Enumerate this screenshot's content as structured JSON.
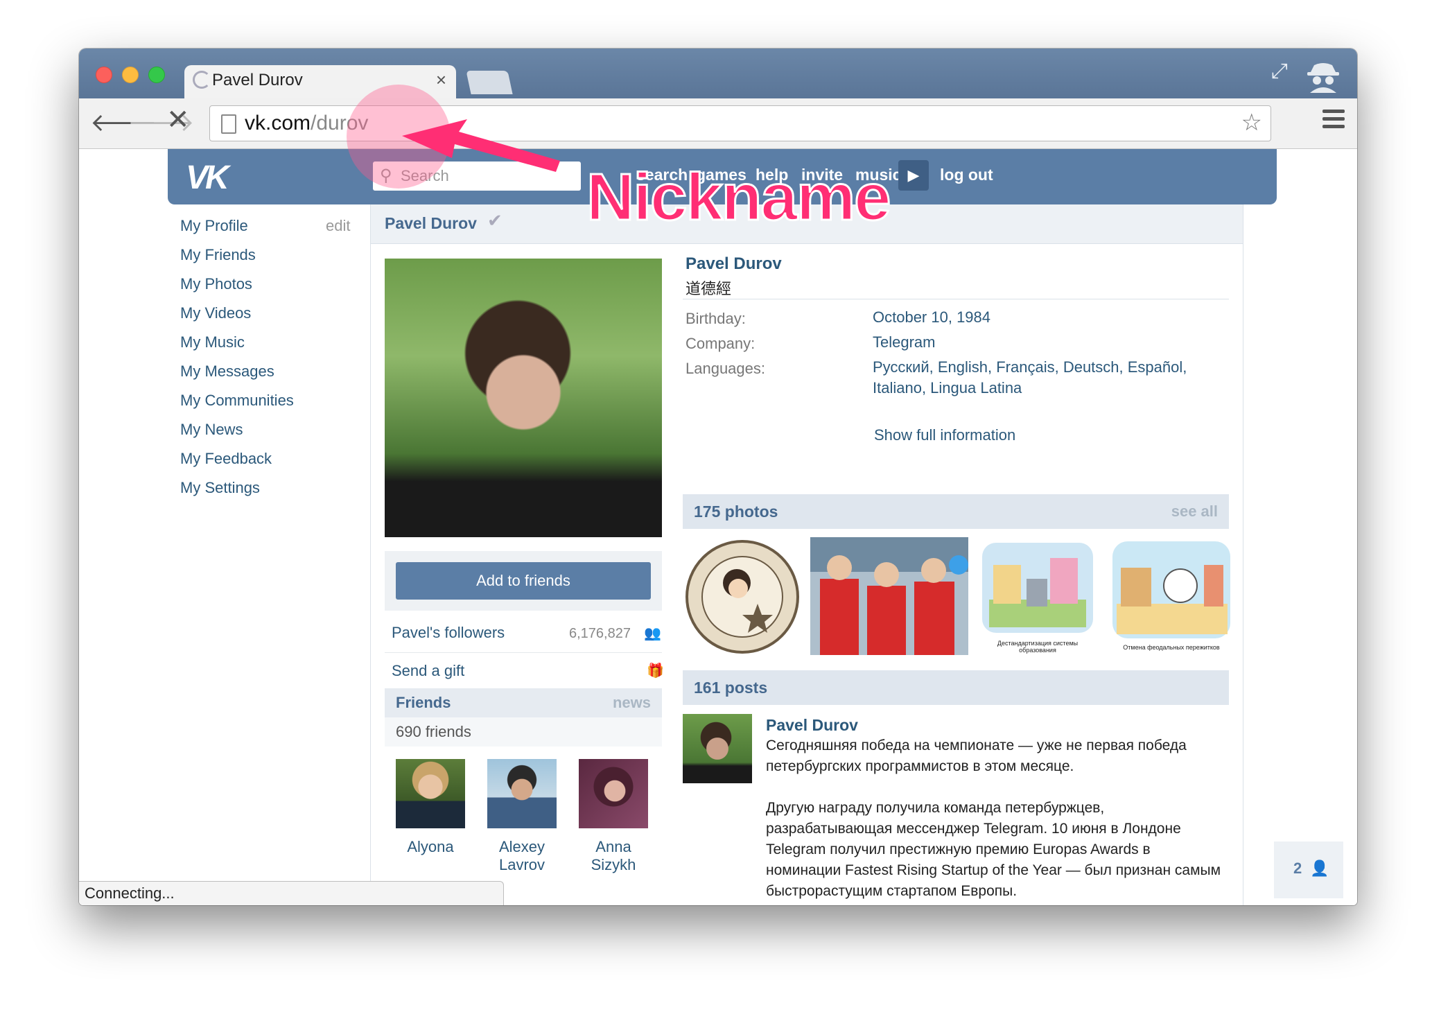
{
  "browser": {
    "tab_title": "Pavel Durov",
    "tab_close": "×",
    "url_host": "vk.com",
    "url_path": "/durov",
    "status": "Connecting..."
  },
  "vk": {
    "search_placeholder": "Search",
    "nav": [
      "search",
      "games",
      "help",
      "invite",
      "music",
      "log out"
    ],
    "left_menu": [
      "My Profile",
      "My Friends",
      "My Photos",
      "My Videos",
      "My Music",
      "My Messages",
      "My Communities",
      "My News",
      "My Feedback",
      "My Settings"
    ],
    "edit_label": "edit",
    "header_name": "Pavel Durov",
    "add_to_friends": "Add to friends",
    "followers_label": "Pavel's followers",
    "followers_count": "6,176,827",
    "send_gift": "Send a gift",
    "friends_title": "Friends",
    "friends_news": "news",
    "friends_count": "690 friends",
    "friends": [
      {
        "first": "Alyona",
        "last": ""
      },
      {
        "first": "Alexey",
        "last": "Lavrov"
      },
      {
        "first": "Anna",
        "last": "Sizykh"
      }
    ],
    "profile": {
      "name": "Pavel Durov",
      "subtitle": "道德經",
      "birthday_label": "Birthday:",
      "birthday": "October 10, 1984",
      "company_label": "Company:",
      "company": "Telegram",
      "languages_label": "Languages:",
      "languages": "Русский, English, Français, Deutsch, Español, Italiano, Lingua Latina",
      "show_full": "Show full information"
    },
    "photos_title": "175 photos",
    "photos_see_all": "see all",
    "posts_title": "161 posts",
    "post": {
      "author": "Pavel Durov",
      "text1": "Сегодняшняя победа на чемпионате — уже не первая победа петербургских программистов в этом месяце.",
      "text2": "Другую награду получила команда петербуржцев, разрабатывающая мессенджер Telegram. 10 июня в Лондоне Telegram получил престижную премию Europas Awards в номинации Fastest Rising Startup of the Year — был признан самым быстрорастущим стартапом Европы."
    },
    "online_count": "2"
  },
  "annotation": {
    "label": "Nickname"
  },
  "colors": {
    "vk_blue": "#5b7ea6",
    "link": "#2b587a",
    "annotation": "#ff2e74"
  }
}
